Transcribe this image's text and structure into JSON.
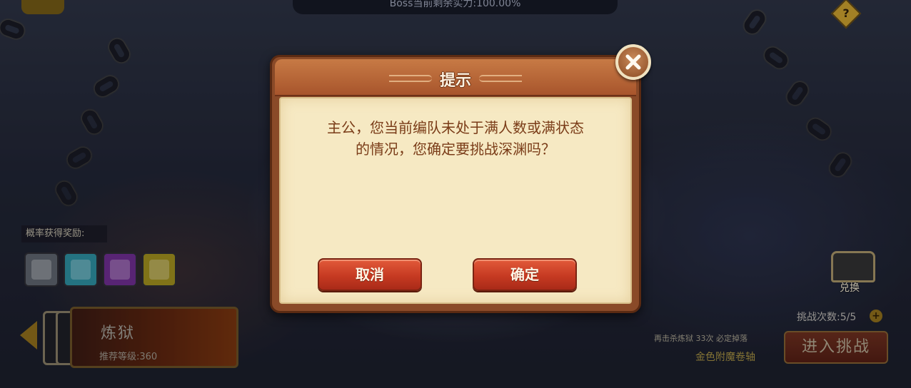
{
  "background": {
    "top_banner_text": "Boss当前剩余实力:100.00%",
    "help_label": "?",
    "reward_label": "概率获得奖励:",
    "rewards": [
      {
        "icon": "scroll-grey-icon",
        "color": "#5a6068"
      },
      {
        "icon": "scroll-cyan-icon",
        "color": "#2a8a9a"
      },
      {
        "icon": "scroll-purple-icon",
        "color": "#6a2a8a"
      },
      {
        "icon": "scroll-gold-icon",
        "color": "#9a8a1a"
      }
    ],
    "stage": {
      "name": "炼狱",
      "recommended_level": "推荐等级:360"
    },
    "exchange_label": "兑换",
    "challenge_count": "挑战次数:5/5",
    "plus_label": "+",
    "drop_note": "再击杀炼狱 33次 必定掉落",
    "drop_item": "金色附魔卷轴",
    "enter_button": "进入挑战"
  },
  "dialog": {
    "title": "提示",
    "message_line1": "主公，您当前编队未处于满人数或满状态",
    "message_line2": "的情况，您确定要挑战深渊吗？",
    "cancel_label": "取消",
    "confirm_label": "确定"
  }
}
